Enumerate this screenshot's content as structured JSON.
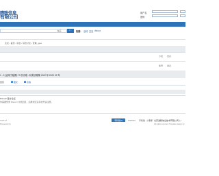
{
  "header": {
    "logo_line1": "際聡信息",
    "logo_line2": "有限公司",
    "login": {
      "username_label": "用户名",
      "password_label": "密码"
    }
  },
  "search": {
    "select_label": "帖子",
    "hot_label": "热搜:",
    "hot_links": [
      "活动",
      "交友",
      "discuz"
    ]
  },
  "breadcrumb": "论坛 › 首页 › 综合 › 综合讨论 › 查看_gjee",
  "posts": [
    {
      "index": "沙发",
      "meta": "发表"
    },
    {
      "index": "板凳",
      "meta": "发表"
    }
  ],
  "thread": {
    "title": "1 - 3 (适用于触屏) 75 份试卷 - 精美试卷集 2022 年 2020 22 年",
    "label_reply": "回复",
    "opt1": "图文",
    "opt2": "表格",
    "notice_title": "Discuz! 官方论坛",
    "notice_text": "你需要登录 Discuz! 才能回复，如果你还没有帐号请注册。"
  },
  "footer": {
    "badge": "手机版(1)",
    "links": [
      "Archiver",
      "手机版",
      "小黑屋"
    ],
    "company": "北京澳聡信息技术有限公司 ( )",
    "left1": "GMT+8",
    "left2": "Powered by",
    "sub": "All rights reserved. Template design by"
  }
}
